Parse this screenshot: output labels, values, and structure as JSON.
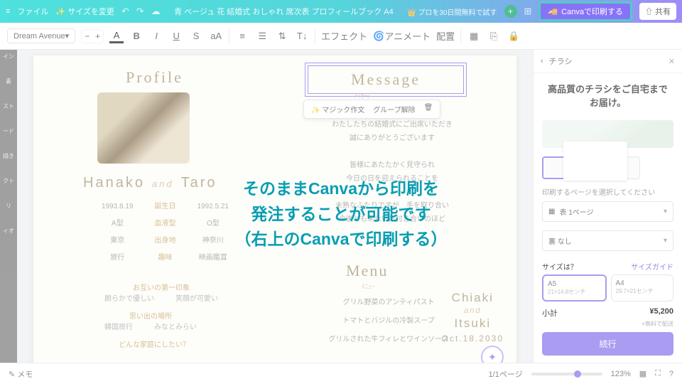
{
  "topbar": {
    "file": "ファイル",
    "resize": "サイズを変更",
    "title": "青 ベージュ 花 結婚式 おしゃれ 席次表 プロフィールブック A4",
    "trial": "プロを30日間無料で試す",
    "print": "Canvaで印刷する",
    "share": "共有"
  },
  "toolbar": {
    "font": "Dream Avenue",
    "size": "",
    "effect": "エフェクト",
    "animate": "アニメート",
    "position": "配置"
  },
  "doc": {
    "profile_h": "Profile",
    "message_h": "Message",
    "msg_small": "ﾒｯｾｰｼﾞ",
    "popup_magic": "✨ マジック作文",
    "popup_ungroup": "グループ解除",
    "names_left": "Hanako",
    "names_and": "and",
    "names_right": "Taro",
    "rows": [
      [
        "1993.8.19",
        "誕生日",
        "1992.5.21"
      ],
      [
        "A型",
        "血液型",
        "O型"
      ],
      [
        "東京",
        "出身地",
        "神奈川"
      ],
      [
        "旅行",
        "趣味",
        "映画鑑賞"
      ]
    ],
    "impr_h": "お互いの第一印象",
    "impr_l": "朗らかで優しい",
    "impr_r": "笑顔が可愛い",
    "memory_h": "思い出の場所",
    "memory_l": "韓国旅行",
    "memory_r": "みなとみらい",
    "home_h": "どんな家庭にしたい？",
    "msg1": "わたしたちの結婚式にご出席いただき",
    "msg2": "誠にありがとうございます",
    "msg3": "皆様にあたたかく見守られ",
    "msg4": "今日の日を迎えられることを",
    "msg5": "未熟なふたりですが　手を取り合い",
    "msg6": "今後とも末永いお付き合いのほど",
    "msg7": "",
    "menu_h": "Menu",
    "menu_small": "ﾒﾆｭｰ",
    "menu1": "グリル野菜のアンティパスト",
    "menu2": "トマトとバジルの冷製スープ",
    "menu3": "グリルされた牛フィレとワインソース",
    "chiaki": "Chiaki",
    "itsuki": "Itsuki",
    "date": "Oct.18.2030"
  },
  "panel": {
    "tab": "チラシ",
    "title": "高品質のチラシをご自宅までお届け。",
    "select_label": "印刷するページを選択してください",
    "sheet_front": "表 1ページ",
    "sheet_back": "裏 なし",
    "size_q": "サイズは？",
    "size_guide": "サイズガイド",
    "a5": "A5",
    "a5_sub": "21×14.8センチ",
    "a4": "A4",
    "a4_sub": "29.7×21センチ",
    "subtotal": "小計",
    "price": "¥5,200",
    "free": "+無料で配送",
    "cta": "続行"
  },
  "bottom": {
    "memo": "メモ",
    "page": "1/1ページ",
    "zoom": "123%"
  },
  "overlay": {
    "l1": "そのままCanvaから印刷を",
    "l2": "発注することが可能です",
    "l3": "（右上のCanvaで印刷する）"
  }
}
